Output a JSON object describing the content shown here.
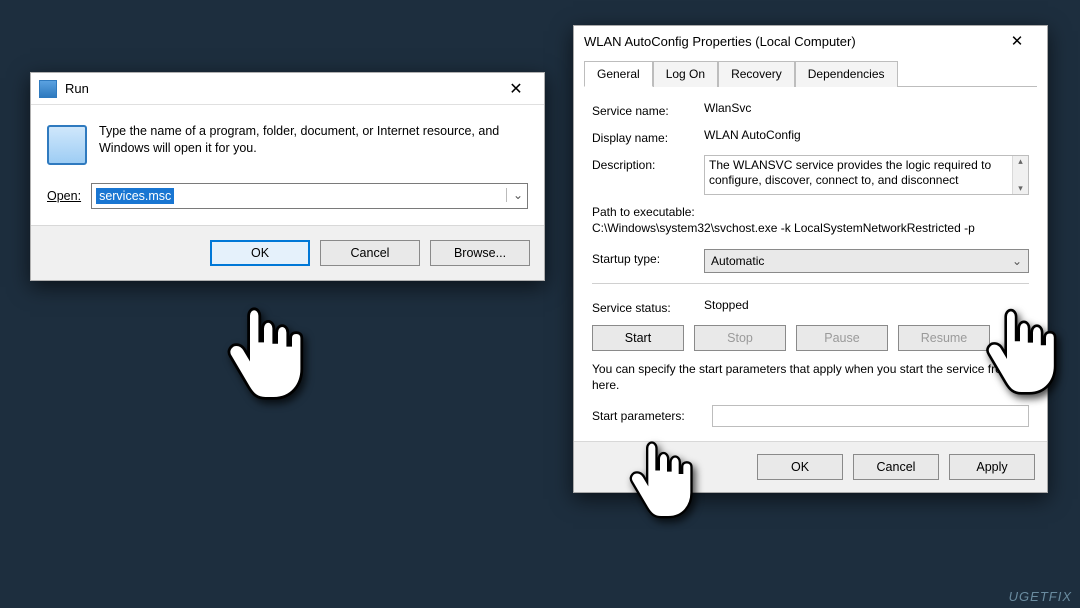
{
  "run": {
    "title": "Run",
    "instruction": "Type the name of a program, folder, document, or Internet resource, and Windows will open it for you.",
    "open_label": "Open:",
    "open_value": "services.msc",
    "buttons": {
      "ok": "OK",
      "cancel": "Cancel",
      "browse": "Browse..."
    }
  },
  "props": {
    "title": "WLAN AutoConfig Properties (Local Computer)",
    "tabs": [
      "General",
      "Log On",
      "Recovery",
      "Dependencies"
    ],
    "active_tab": "General",
    "service_name_label": "Service name:",
    "service_name": "WlanSvc",
    "display_name_label": "Display name:",
    "display_name": "WLAN AutoConfig",
    "description_label": "Description:",
    "description": "The WLANSVC service provides the logic required to configure, discover, connect to, and disconnect",
    "path_label": "Path to executable:",
    "path_value": "C:\\Windows\\system32\\svchost.exe -k LocalSystemNetworkRestricted -p",
    "startup_label": "Startup type:",
    "startup_value": "Automatic",
    "status_label": "Service status:",
    "status_value": "Stopped",
    "ctrl": {
      "start": "Start",
      "stop": "Stop",
      "pause": "Pause",
      "resume": "Resume"
    },
    "hint": "You can specify the start parameters that apply when you start the service from here.",
    "start_params_label": "Start parameters:",
    "start_params_value": "",
    "buttons": {
      "ok": "OK",
      "cancel": "Cancel",
      "apply": "Apply"
    }
  },
  "watermark": "UGETFIX"
}
